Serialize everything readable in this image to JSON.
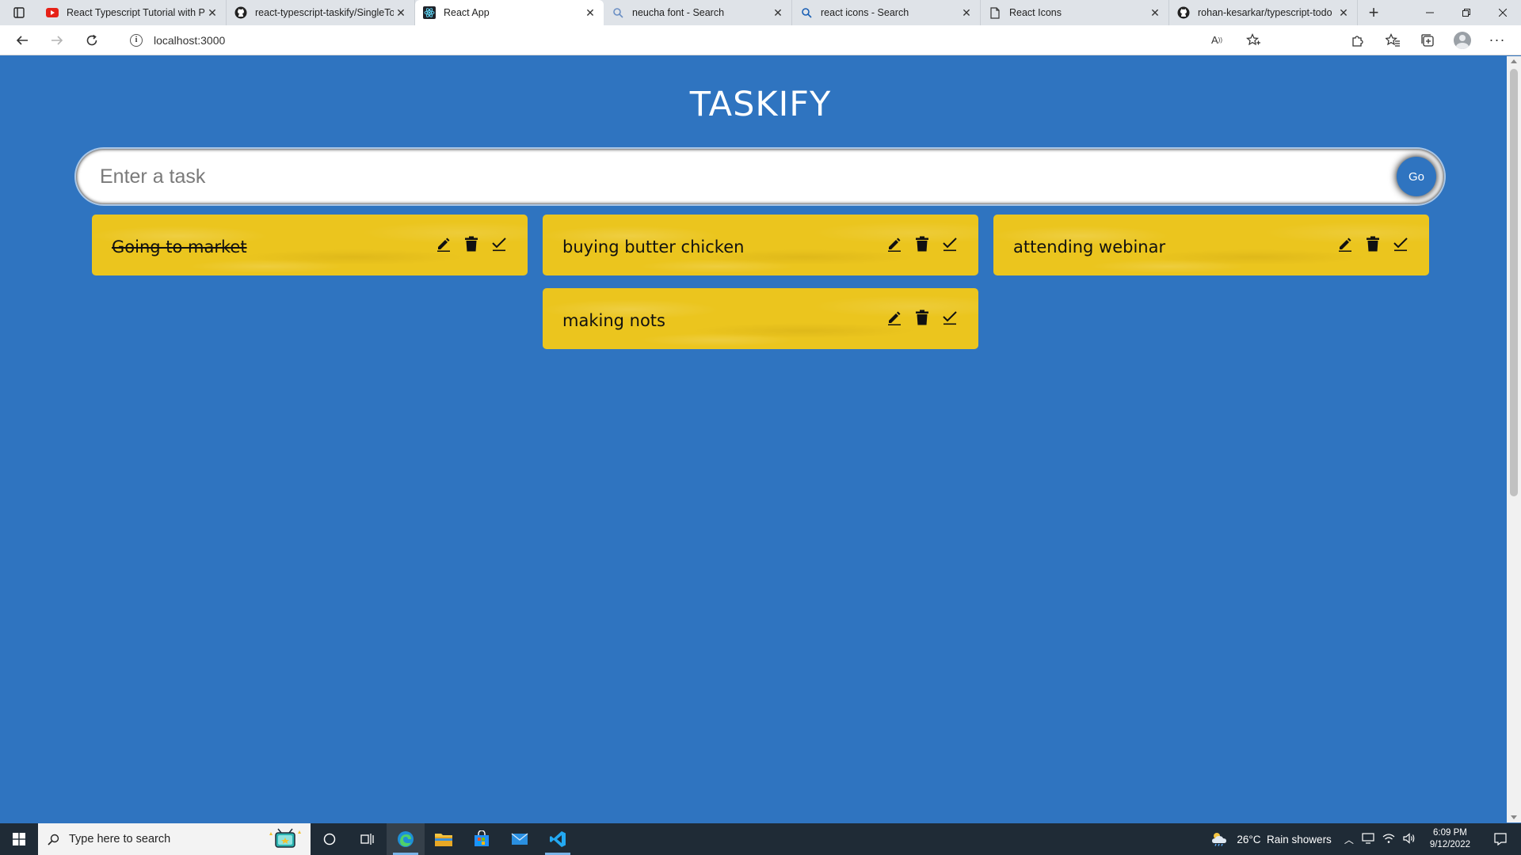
{
  "browser": {
    "tabs": [
      {
        "title": "React Typescript Tutorial with Pr",
        "icon": "youtube-icon",
        "active": false
      },
      {
        "title": "react-typescript-taskify/SingleTo",
        "icon": "github-icon",
        "active": false
      },
      {
        "title": "React App",
        "icon": "react-icon",
        "active": true
      },
      {
        "title": "neucha font - Search",
        "icon": "search-icon",
        "active": false
      },
      {
        "title": "react icons - Search",
        "icon": "search-icon",
        "active": false
      },
      {
        "title": "React Icons",
        "icon": "page-icon",
        "active": false
      },
      {
        "title": "rohan-kesarkar/typescript-todo",
        "icon": "github-icon",
        "active": false
      }
    ],
    "url": "localhost:3000"
  },
  "app": {
    "title": "TASKIFY",
    "input_placeholder": "Enter a task",
    "input_value": "",
    "go_label": "Go",
    "accent_color": "#2f74c0",
    "card_color": "#ebc51e",
    "columns": [
      [
        {
          "text": "Going to market",
          "done": true
        }
      ],
      [
        {
          "text": "buying butter chicken",
          "done": false
        },
        {
          "text": "making nots",
          "done": false
        }
      ],
      [
        {
          "text": "attending webinar",
          "done": false
        }
      ]
    ]
  },
  "taskbar": {
    "search_placeholder": "Type here to search",
    "weather": "26°C  Rain showers",
    "time": "6:09 PM",
    "date": "9/12/2022"
  }
}
